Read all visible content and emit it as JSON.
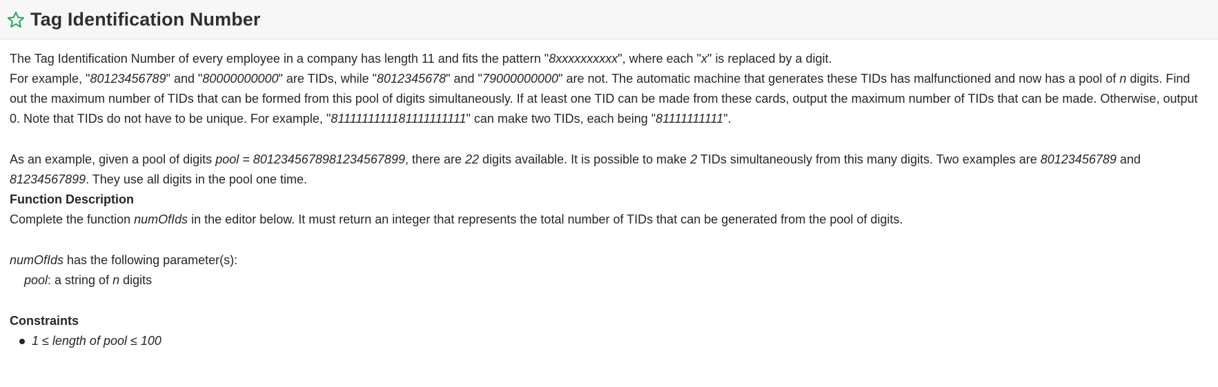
{
  "header": {
    "title": "Tag Identification Number",
    "star_icon": "star-outline-icon",
    "star_color": "#1ba94c"
  },
  "description": {
    "p1": {
      "t1": "The Tag Identification Number of every employee in a company has length 11 and fits the pattern \"",
      "e1": "8xxxxxxxxxx",
      "t2": "\", where each \"",
      "e2": "x",
      "t3": "\" is replaced by a digit."
    },
    "p2": {
      "t1": "For example, \"",
      "e1": "80123456789",
      "t2": "\" and \"",
      "e2": "80000000000",
      "t3": "\" are TIDs, while \"",
      "e3": "8012345678",
      "t4": "\" and \"",
      "e4": "79000000000",
      "t5": "\" are not. The automatic machine that generates these TIDs has malfunctioned and now has a pool of ",
      "e5": "n",
      "t6": " digits. Find out the maximum number of TIDs that can be formed from this pool of digits simultaneously. If at least one TID can be made from these cards, output the maximum number of TIDs that can be made. Otherwise, output 0. Note that TIDs do not have to be unique. For example, \"",
      "e6": "8111111111181111111111",
      "t7": "\" can make two TIDs, each being \"",
      "e7": "81111111111",
      "t8": "\"."
    },
    "p3": {
      "t1": "As an example, given a pool of digits ",
      "e1": "pool = 8012345678981234567899",
      "t2": ", there are ",
      "e2": "22",
      "t3": " digits available. It is possible to make ",
      "e3": "2",
      "t4": " TIDs simultaneously from this many digits. Two examples are ",
      "e4": "80123456789",
      "t5": " and ",
      "e5": "81234567899",
      "t6": ".  They use all digits in the pool one time."
    }
  },
  "function_description": {
    "heading": "Function Description",
    "t1": "Complete the function ",
    "e1": "numOfIds",
    "t2": " in the editor below. It must return an integer that represents the total number of TIDs that can be generated from the pool of digits."
  },
  "parameters": {
    "e1": "numOfIds",
    "t1": " has the following parameter(s):",
    "param_name": "pool",
    "param_sep": ":  a string of ",
    "param_n": "n",
    "param_tail": " digits"
  },
  "constraints": {
    "heading": "Constraints",
    "items": [
      "1 ≤ length of pool ≤ 100"
    ]
  }
}
